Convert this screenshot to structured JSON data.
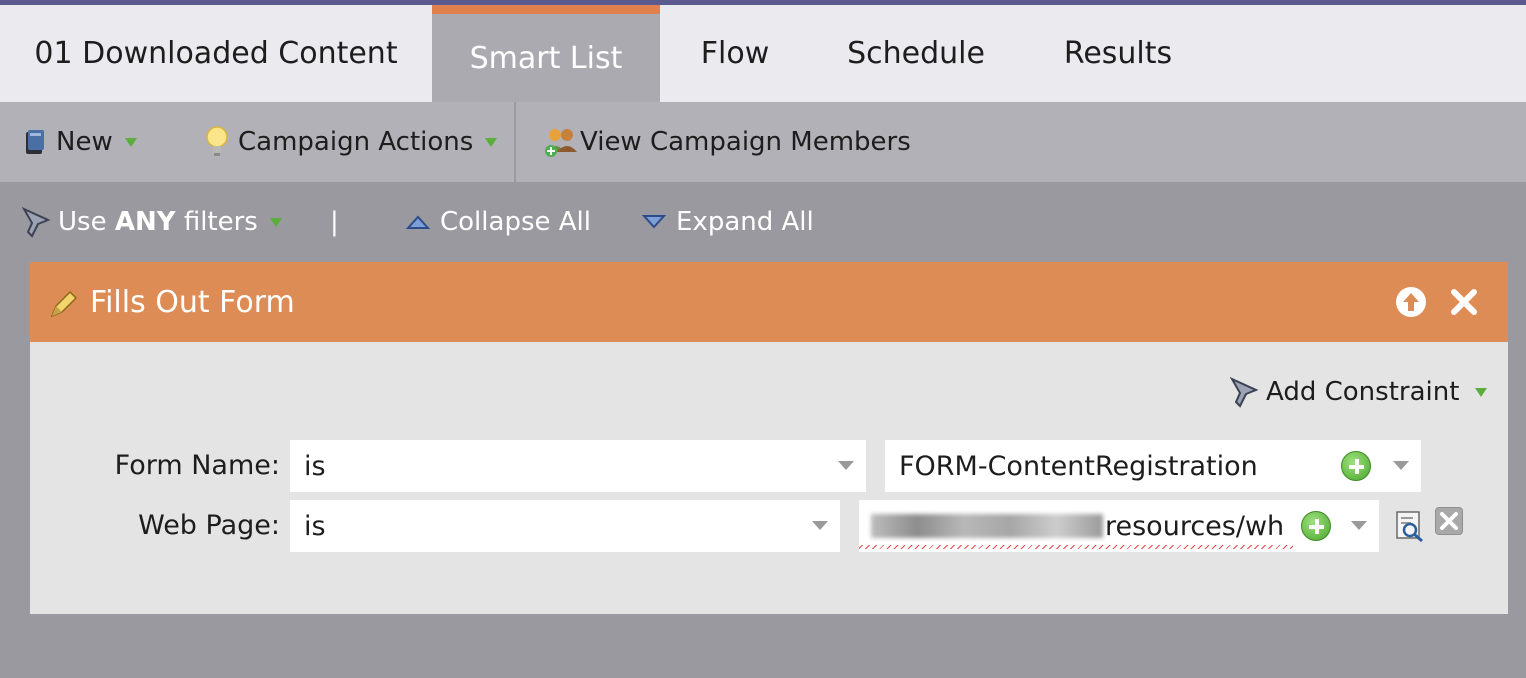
{
  "tabs": [
    {
      "label": "01 Downloaded Content"
    },
    {
      "label": "Smart List"
    },
    {
      "label": "Flow"
    },
    {
      "label": "Schedule"
    },
    {
      "label": "Results"
    }
  ],
  "active_tab": "Smart List",
  "toolbar": {
    "new_label": "New",
    "campaign_actions_label": "Campaign Actions",
    "view_members_label": "View Campaign Members"
  },
  "filterbar": {
    "use_label": "Use ",
    "use_bold": "ANY",
    "filters_label": " filters",
    "separator": "|",
    "collapse_label": "Collapse All",
    "expand_label": "Expand All"
  },
  "filter": {
    "title": "Fills Out Form",
    "add_constraint_label": "Add Constraint",
    "rows": [
      {
        "label": "Form Name:",
        "operator": "is",
        "value": "FORM-ContentRegistration"
      },
      {
        "label": "Web Page:",
        "operator": "is",
        "value": "resources/whi"
      }
    ]
  },
  "colors": {
    "accent": "#e0804c",
    "card_header": "#de8c55",
    "tab_active": "#abaab1",
    "toolbar": "#b2b1b7",
    "background": "#9a999f",
    "dropdown_indicator": "#5cae3c"
  },
  "icons": [
    "book-icon",
    "lightbulb-icon",
    "members-icon",
    "funnel-icon",
    "collapse-icon",
    "expand-icon",
    "form-pencil-icon",
    "move-up-icon",
    "close-icon",
    "add-icon",
    "lookup-icon",
    "remove-icon"
  ]
}
